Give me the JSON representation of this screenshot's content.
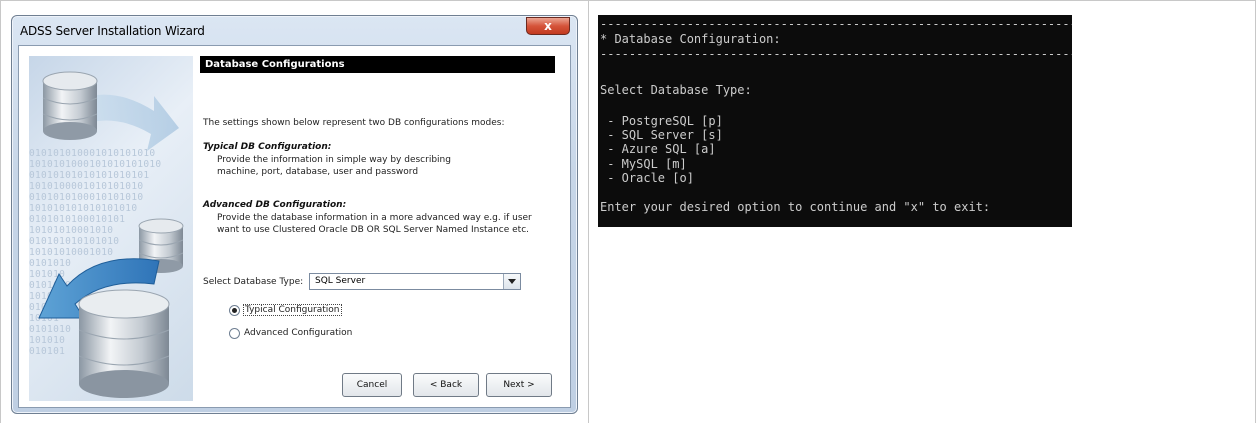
{
  "wizard": {
    "title": "ADSS Server Installation Wizard",
    "close_label": "x",
    "header": "Database Configurations",
    "intro": "The settings shown below represent two DB configurations modes:",
    "typical_heading": "Typical DB Configuration:",
    "typical_desc_1": "Provide the information in simple way by describing",
    "typical_desc_2": "machine, port, database, user and password",
    "advanced_heading": "Advanced DB Configuration:",
    "advanced_desc_1": "Provide the database information in a more advanced way e.g. if user",
    "advanced_desc_2": "want to use Clustered Oracle DB OR SQL Server Named Instance etc.",
    "select_label": "Select Database Type:",
    "select_value": "SQL Server",
    "radio_typical": "Typical Configuration",
    "radio_advanced": "Advanced Configuration",
    "radio_selected": "typical",
    "btn_cancel": "Cancel",
    "btn_back": "< Back",
    "btn_next": "Next >",
    "banner_binary": [
      "010101010001010101010",
      "1010101000101010101010",
      "01010101010101010101",
      "1010100001010101010",
      "0101010100010101010",
      "101010101010101010",
      "0101010100010101",
      "10101010001010",
      "010101010101010",
      "10101010001010",
      "0101010",
      "101010",
      "0101010",
      "1010101",
      "010101",
      "10101",
      "0101010",
      "101010",
      "010101"
    ]
  },
  "console": {
    "separator": "--------------------------------------------------------------------",
    "title": "* Database Configuration:",
    "prompt_heading": "Select Database Type:",
    "options": [
      " - PostgreSQL [p]",
      " - SQL Server [s]",
      " - Azure SQL [a]",
      " - MySQL [m]",
      " - Oracle [o]"
    ],
    "input_prompt": "Enter your desired option to continue and \"x\" to exit:"
  },
  "colors": {
    "console_bg": "#0c0c0c",
    "console_fg": "#cccccc",
    "wizard_frame": "#c7d6e8",
    "close_button": "#c23a20"
  }
}
